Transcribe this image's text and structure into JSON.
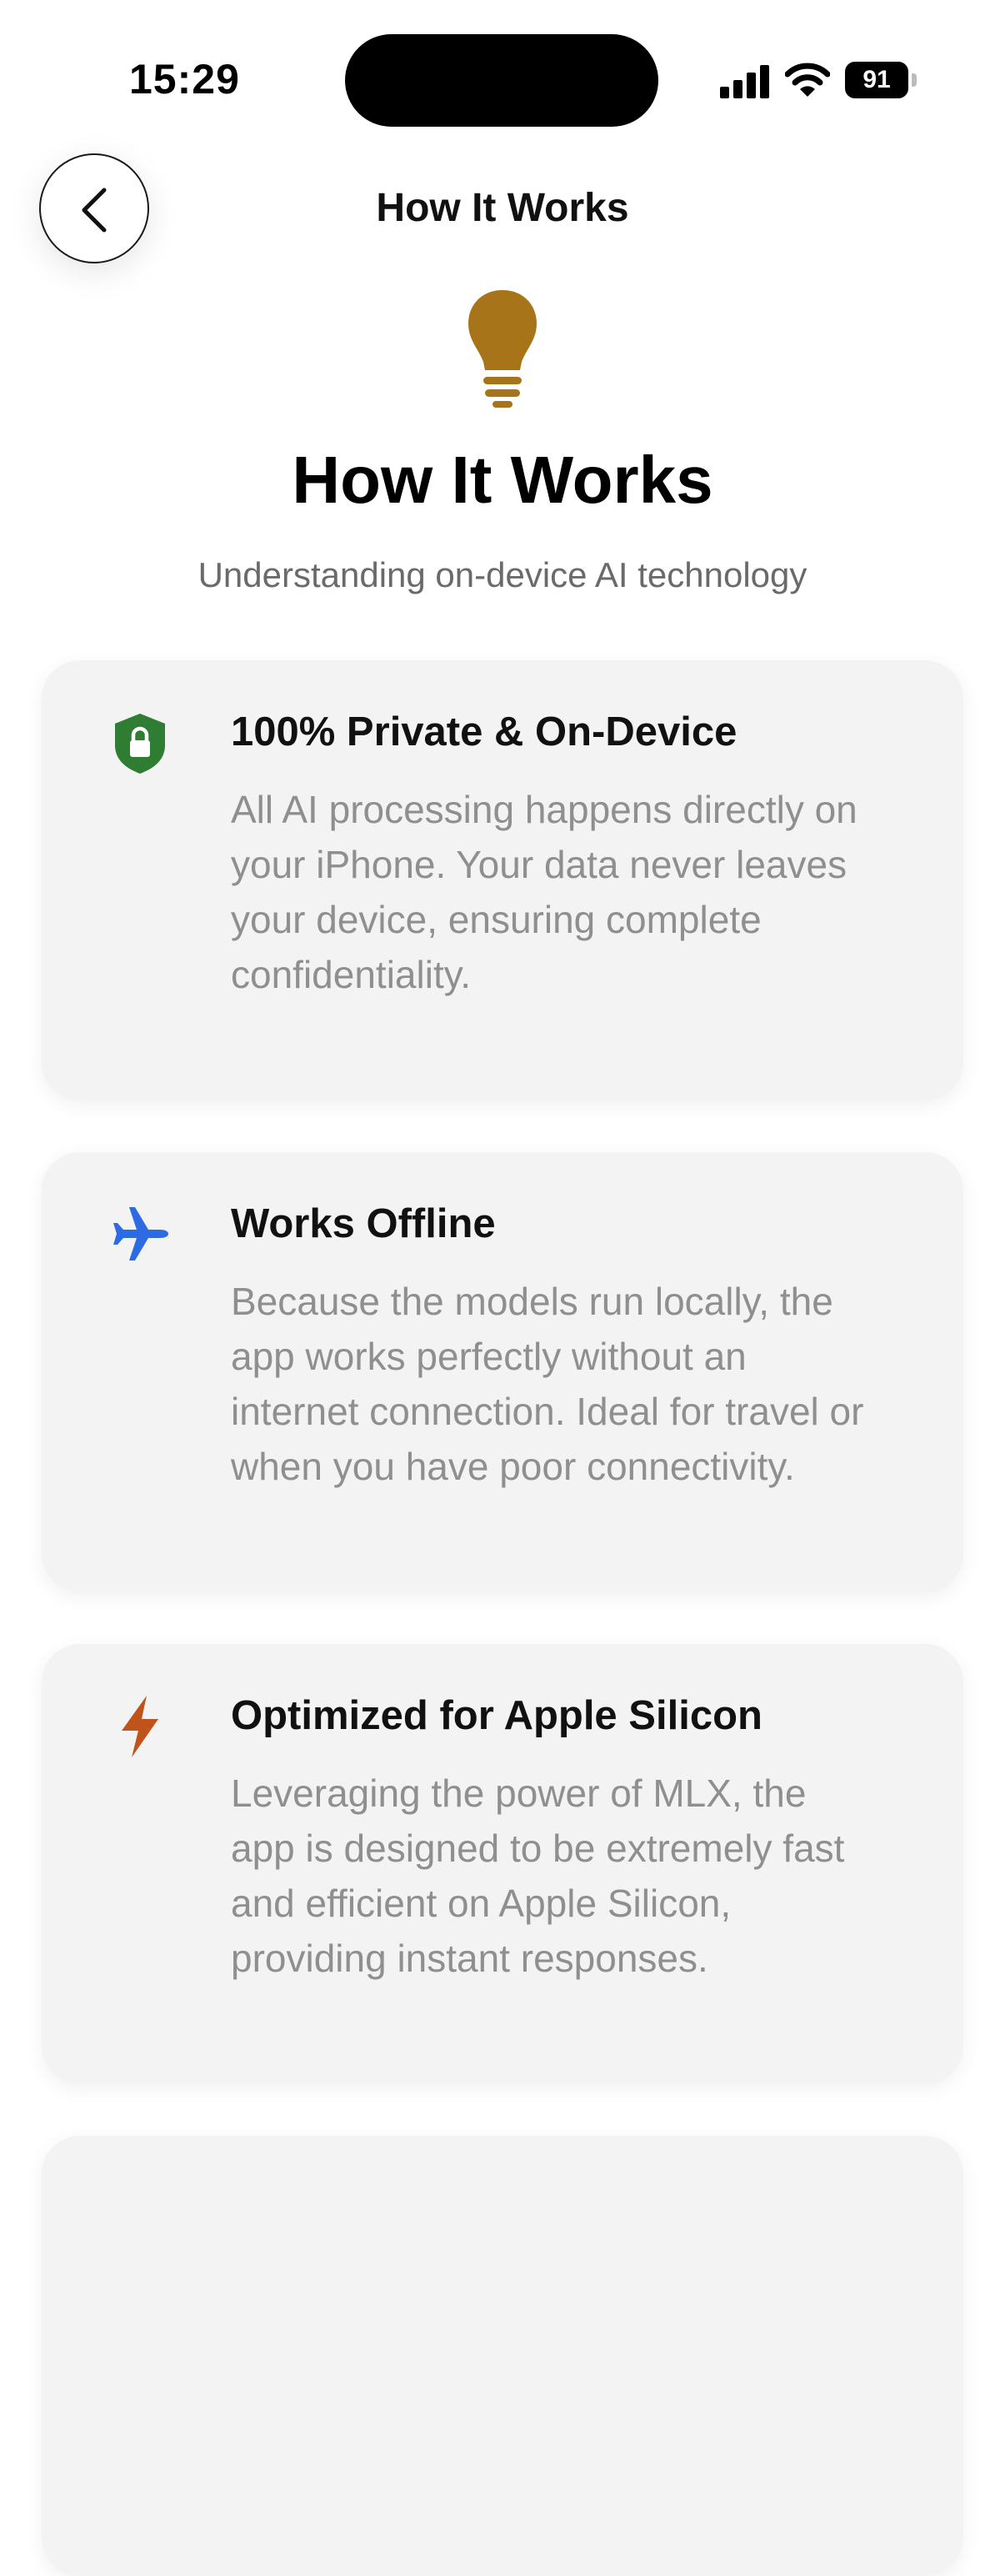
{
  "status_bar": {
    "time": "15:29",
    "battery": "91"
  },
  "nav": {
    "title": "How It Works"
  },
  "hero": {
    "title": "How It Works",
    "subtitle": "Understanding on-device AI technology"
  },
  "cards": [
    {
      "title": "100% Private & On-Device",
      "body": "All AI processing happens directly on your iPhone. Your data never leaves your device, ensuring complete confidentiality.",
      "icon": "lock-shield-icon",
      "color": "#2e7d32"
    },
    {
      "title": "Works Offline",
      "body": "Because the models run locally, the app works perfectly without an internet connection. Ideal for travel or when you have poor connectivity.",
      "icon": "airplane-icon",
      "color": "#2d6be4"
    },
    {
      "title": "Optimized for Apple Silicon",
      "body": "Leveraging the power of MLX, the app is designed to be extremely fast and efficient on Apple Silicon, providing instant responses.",
      "icon": "bolt-icon",
      "color": "#c0531a"
    }
  ],
  "colors": {
    "bulb": "#a8741a",
    "background": "#ffffff",
    "card": "#f3f3f3",
    "secondary_text": "#8f8f8f"
  }
}
